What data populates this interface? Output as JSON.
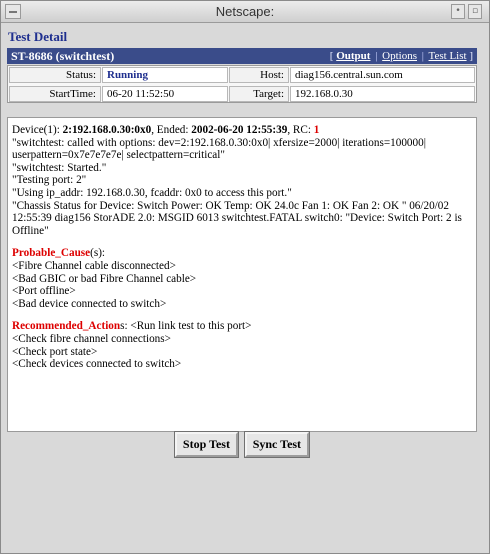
{
  "window": {
    "title": "Netscape:"
  },
  "page": {
    "heading": "Test Detail"
  },
  "header_bar": {
    "test_id": "ST-8686 (switchtest)",
    "links": [
      "Output",
      "Options",
      "Test List"
    ],
    "link_open": "[",
    "link_close": "]",
    "separator": "|"
  },
  "info": {
    "status_label": "Status:",
    "status_value": "Running",
    "host_label": "Host:",
    "host_value": "diag156.central.sun.com",
    "start_label": "StartTime:",
    "start_value": "06-20 11:52:50",
    "target_label": "Target:",
    "target_value": "192.168.0.30"
  },
  "log": {
    "device_prefix": "Device(1): ",
    "device_id": "2:192.168.0.30:0x0",
    "ended_label": ",  Ended: ",
    "ended_value": "2002-06-20 12:55:39",
    "rc_label": ",  RC: ",
    "rc_value": "1",
    "lines": [
      "\"switchtest: called with options: dev=2:192.168.0.30:0x0| xfersize=2000| iterations=100000| userpattern=0x7e7e7e7e| selectpattern=critical\"",
      "\"switchtest: Started.\"",
      "\"Testing port: 2\"",
      "\"Using ip_addr: 192.168.0.30, fcaddr: 0x0 to access this port.\"",
      "\"Chassis Status for Device: Switch Power: OK Temp: OK 24.0c Fan 1: OK Fan 2: OK \" 06/20/02 12:55:39 diag156 StorADE 2.0: MSGID 6013 switchtest.FATAL switch0: \"Device: Switch Port: 2 is Offline\""
    ],
    "probable_cause_label": "Probable_Cause",
    "probable_cause_suffix": "(s):",
    "probable_causes": [
      "<Fibre Channel cable disconnected>",
      "<Bad GBIC or bad Fibre Channel cable>",
      "<Port offline>",
      "<Bad device connected to switch>"
    ],
    "recommended_label": "Recommended_Action",
    "recommended_suffix": "s: <Run link test to this port>",
    "recommended_actions": [
      "<Check fibre channel connections>",
      "<Check port state>",
      "<Check devices connected to switch>"
    ]
  },
  "buttons": {
    "stop": "Stop Test",
    "sync": "Sync Test"
  },
  "colors": {
    "header_bar": "#3a4c8a",
    "heading": "#1f2f8f",
    "error_red": "#dd0000"
  }
}
